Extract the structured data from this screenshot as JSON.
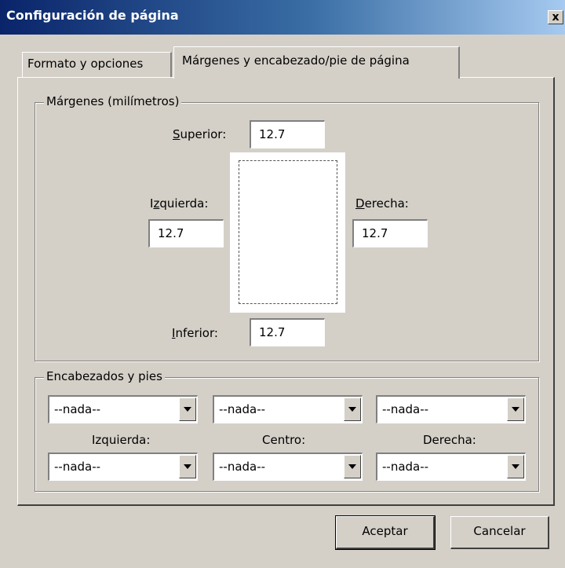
{
  "window": {
    "title": "Configuración de página",
    "close_glyph": "x"
  },
  "tabs": [
    {
      "label": "Formato y opciones",
      "active": false
    },
    {
      "label": "Márgenes y encabezado/pie de página",
      "active": true
    }
  ],
  "margins": {
    "legend": "Márgenes (milímetros)",
    "top": {
      "accel": "S",
      "rest": "uperior:",
      "value": "12.7"
    },
    "left": {
      "pre": "I",
      "accel": "z",
      "rest": "quierda:",
      "value": "12.7"
    },
    "right": {
      "accel": "D",
      "rest": "erecha:",
      "value": "12.7"
    },
    "bottom": {
      "accel": "I",
      "rest": "nferior:",
      "value": "12.7"
    }
  },
  "headers_footers": {
    "legend": "Encabezados y pies",
    "headers": [
      "--nada--",
      "--nada--",
      "--nada--"
    ],
    "labels": [
      "Izquierda:",
      "Centro:",
      "Derecha:"
    ],
    "footers": [
      "--nada--",
      "--nada--",
      "--nada--"
    ]
  },
  "buttons": {
    "ok": "Aceptar",
    "cancel": "Cancelar"
  }
}
